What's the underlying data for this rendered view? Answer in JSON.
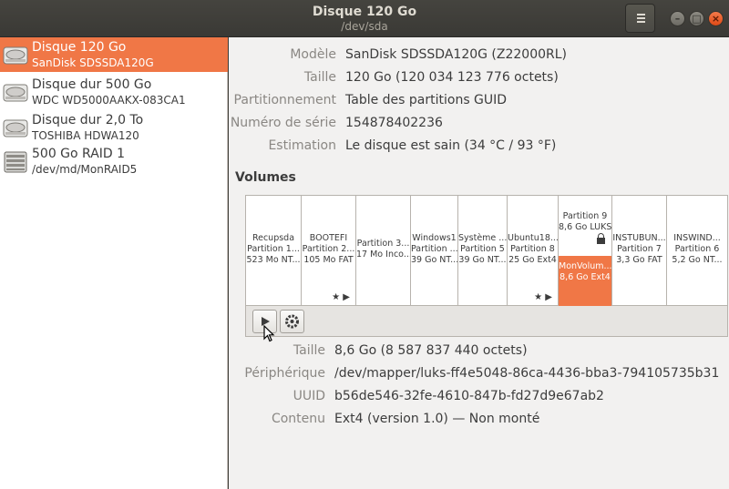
{
  "header": {
    "title": "Disque 120 Go",
    "subtitle": "/dev/sda",
    "menu_icon": "hamburger-icon",
    "window_buttons": [
      "minimize-icon",
      "maximize-icon",
      "close-icon"
    ]
  },
  "sidebar": {
    "items": [
      {
        "name": "Disque 120 Go",
        "sub": "SanDisk SDSSDA120G",
        "icon": "hard-disk-icon",
        "selected": true
      },
      {
        "name": "Disque dur 500 Go",
        "sub": "WDC WD5000AAKX-083CA1",
        "icon": "hard-disk-icon",
        "selected": false
      },
      {
        "name": "Disque dur 2,0 To",
        "sub": "TOSHIBA HDWA120",
        "icon": "hard-disk-icon",
        "selected": false
      },
      {
        "name": "500 Go RAID 1",
        "sub": "/dev/md/MonRAID5",
        "icon": "raid-array-icon",
        "selected": false
      }
    ]
  },
  "disk": {
    "model_label": "Modèle",
    "model": "SanDisk SDSSDA120G (Z22000RL)",
    "size_label": "Taille",
    "size": "120 Go (120 034 123 776 octets)",
    "partitioning_label": "Partitionnement",
    "partitioning": "Table des partitions GUID",
    "serial_label": "Numéro de série",
    "serial": "154878402236",
    "assessment_label": "Estimation",
    "assessment": "Le disque est sain (34 °C / 93 °F)"
  },
  "volumes": {
    "title": "Volumes",
    "items": [
      {
        "l1": "Recupsda",
        "l2": "Partition 1...",
        "l3": "523 Mo NT..."
      },
      {
        "l1": "BOOTEFI",
        "l2": "Partition 2...",
        "l3": "105 Mo FAT",
        "marks": "★ ▶"
      },
      {
        "l1": "Partition 3...",
        "l2": "17 Mo Inco...",
        "l3": ""
      },
      {
        "l1": "Windows1",
        "l2": "Partition ...",
        "l3": "39 Go NT..."
      },
      {
        "l1": "Système ...",
        "l2": "Partition 5",
        "l3": "39 Go NT..."
      },
      {
        "l1": "Ubuntu18...",
        "l2": "Partition 8",
        "l3": "25 Go Ext4",
        "marks": "★ ▶"
      },
      {
        "top1": "Partition 9",
        "top2": "8,6 Go LUKS",
        "bottom1": "MonVolum...",
        "bottom2": "8,6 Go Ext4"
      },
      {
        "l1": "INSTUBUN...",
        "l2": "Partition 7",
        "l3": "3,3 Go FAT"
      },
      {
        "l1": "INSWIND...",
        "l2": "Partition 6",
        "l3": "5,2 Go NT..."
      }
    ]
  },
  "toolbar": {
    "play_icon": "play-icon",
    "settings_icon": "gear-icon"
  },
  "volume_details": {
    "size_label": "Taille",
    "size": "8,6 Go (8 587 837 440 octets)",
    "device_label": "Périphérique",
    "device": "/dev/mapper/luks-ff4e5048-86ca-4436-bba3-794105735b31",
    "uuid_label": "UUID",
    "uuid": "b56de546-32fe-4610-847b-fd27d9e67ab2",
    "contents_label": "Contenu",
    "contents": "Ext4 (version 1.0) — Non monté"
  },
  "colors": {
    "accent": "#f07746",
    "titlebar": "#3c3b37",
    "close": "#e95420"
  }
}
